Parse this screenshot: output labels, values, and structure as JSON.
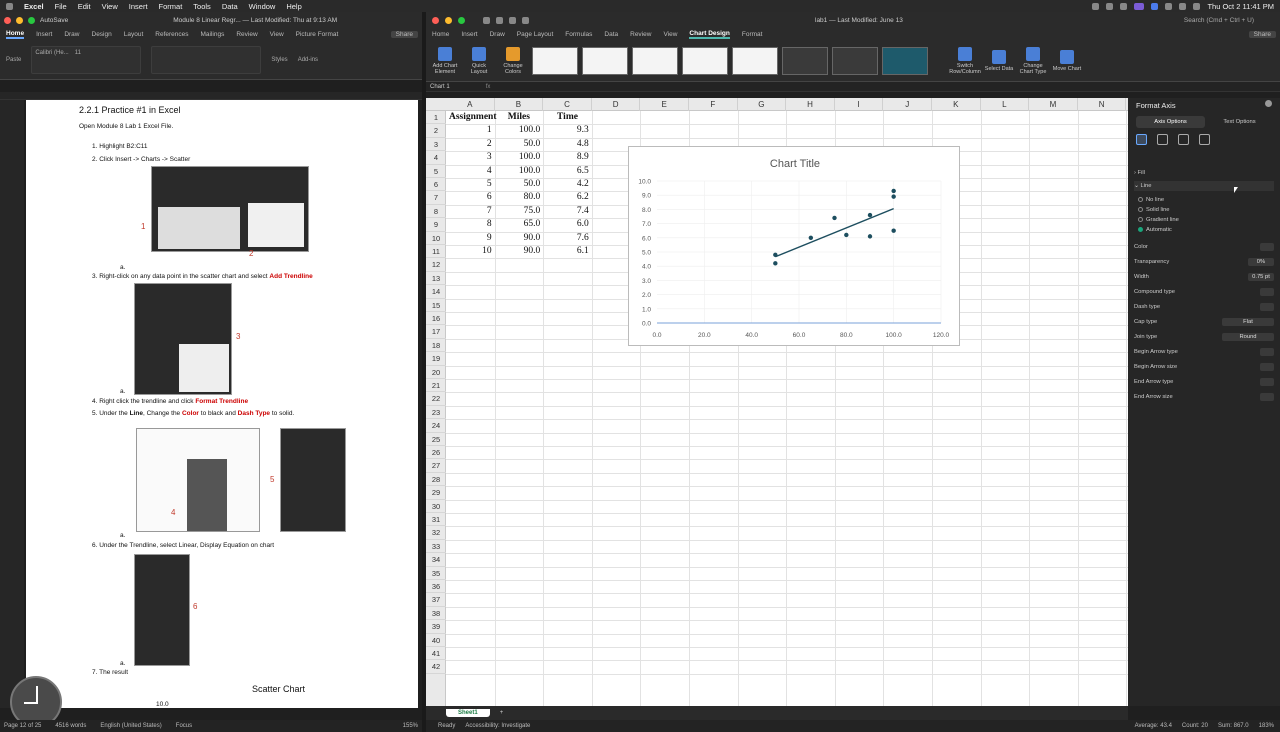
{
  "menubar": {
    "items": [
      "Excel",
      "File",
      "Edit",
      "View",
      "Insert",
      "Format",
      "Tools",
      "Data",
      "Window",
      "Help"
    ],
    "clock": "Thu Oct 2  11:41 PM"
  },
  "word": {
    "autosave": "AutoSave",
    "title": "Module 8 Linear Regr... — Last Modified: Thu at 9:13 AM",
    "tabs": [
      "Home",
      "Insert",
      "Draw",
      "Design",
      "Layout",
      "References",
      "Mailings",
      "Review",
      "View",
      "Picture Format"
    ],
    "font_name": "Calibri (He...",
    "font_size": "11",
    "share": "Share",
    "ribbon_labels": [
      "Paste",
      "Styles",
      "Add-ins"
    ],
    "heading": "2.2.1 Practice #1 in Excel",
    "intro": "Open Module 8 Lab 1 Excel File.",
    "step1": "1.   Highlight B2:C11",
    "step2": "2.   Click Insert -> Charts -> Scatter",
    "step3a": "3.   Right-click on any data point in the scatter chart and select ",
    "step3b": "Add Trendline",
    "step4a": "4.   Right click the trendline and click ",
    "step4b": "Format Trendline",
    "step5": {
      "a": "5.   Under the ",
      "b": "Line",
      "c": ", Change the ",
      "d": "Color",
      "e": " to black and ",
      "f": "Dash Type",
      "g": " to solid."
    },
    "step6": "6.   Under the Trendline, select Linear, Display Equation on chart",
    "step7": "7.   The result",
    "sub_a": "a.",
    "callouts": [
      "1",
      "2",
      "3",
      "4",
      "5",
      "6"
    ],
    "result_title": "Scatter Chart",
    "result_ytick": "10.0",
    "status": [
      "Page 12 of 25",
      "4516 words",
      "English (United States)",
      "Focus",
      "155%"
    ]
  },
  "excel": {
    "title": "lab1 — Last Modified: June 13",
    "tabs": [
      "Home",
      "Insert",
      "Draw",
      "Page Layout",
      "Formulas",
      "Data",
      "Review",
      "View",
      "Chart Design",
      "Format"
    ],
    "share": "Share",
    "search": "Search (Cmd + Ctrl + U)",
    "ribbon": [
      "Add Chart Element",
      "Quick Layout",
      "Change Colors",
      "Switch Row/Column",
      "Select Data",
      "Change Chart Type",
      "Move Chart"
    ],
    "namebox": "Chart 1",
    "fx": "fx",
    "columns": [
      "A",
      "B",
      "C",
      "D",
      "E",
      "F",
      "G",
      "H",
      "I",
      "J",
      "K",
      "L",
      "M",
      "N"
    ],
    "headers": [
      "Assignment",
      "Miles",
      "Time"
    ],
    "rows": [
      [
        "1",
        "100.0",
        "9.3"
      ],
      [
        "2",
        "50.0",
        "4.8"
      ],
      [
        "3",
        "100.0",
        "8.9"
      ],
      [
        "4",
        "100.0",
        "6.5"
      ],
      [
        "5",
        "50.0",
        "4.2"
      ],
      [
        "6",
        "80.0",
        "6.2"
      ],
      [
        "7",
        "75.0",
        "7.4"
      ],
      [
        "8",
        "65.0",
        "6.0"
      ],
      [
        "9",
        "90.0",
        "7.6"
      ],
      [
        "10",
        "90.0",
        "6.1"
      ]
    ],
    "sheet": "Sheet1",
    "status_left": [
      "Ready",
      "Accessibility: Investigate"
    ],
    "status_right": [
      "Average: 43.4",
      "Count: 20",
      "Sum: 867.0",
      "183%"
    ]
  },
  "chart_data": {
    "type": "scatter",
    "title": "Chart Title",
    "x": [
      100,
      50,
      100,
      100,
      50,
      80,
      75,
      65,
      90,
      90
    ],
    "y": [
      9.3,
      4.8,
      8.9,
      6.5,
      4.2,
      6.2,
      7.4,
      6.0,
      7.6,
      6.1
    ],
    "xlim": [
      0,
      120
    ],
    "ylim": [
      0,
      10
    ],
    "xticks": [
      "0.0",
      "20.0",
      "40.0",
      "60.0",
      "80.0",
      "100.0",
      "120.0"
    ],
    "yticks": [
      "0.0",
      "1.0",
      "2.0",
      "3.0",
      "4.0",
      "5.0",
      "6.0",
      "7.0",
      "8.0",
      "9.0",
      "10.0"
    ],
    "trendline": "linear",
    "marker_color": "#1d4e5f"
  },
  "pane": {
    "title": "Format Axis",
    "tabs": [
      "Axis Options",
      "Text Options"
    ],
    "fill": "Fill",
    "line": "Line",
    "line_options": [
      "No line",
      "Solid line",
      "Gradient line",
      "Automatic"
    ],
    "color": "Color",
    "transparency": "Transparency",
    "transparency_val": "0%",
    "width": "Width",
    "width_val": "0.75 pt",
    "compound": "Compound type",
    "dash": "Dash type",
    "cap": "Cap type",
    "cap_val": "Flat",
    "join": "Join type",
    "join_val": "Round",
    "begin_type": "Begin Arrow type",
    "begin_size": "Begin Arrow size",
    "end_type": "End Arrow type",
    "end_size": "End Arrow size"
  }
}
